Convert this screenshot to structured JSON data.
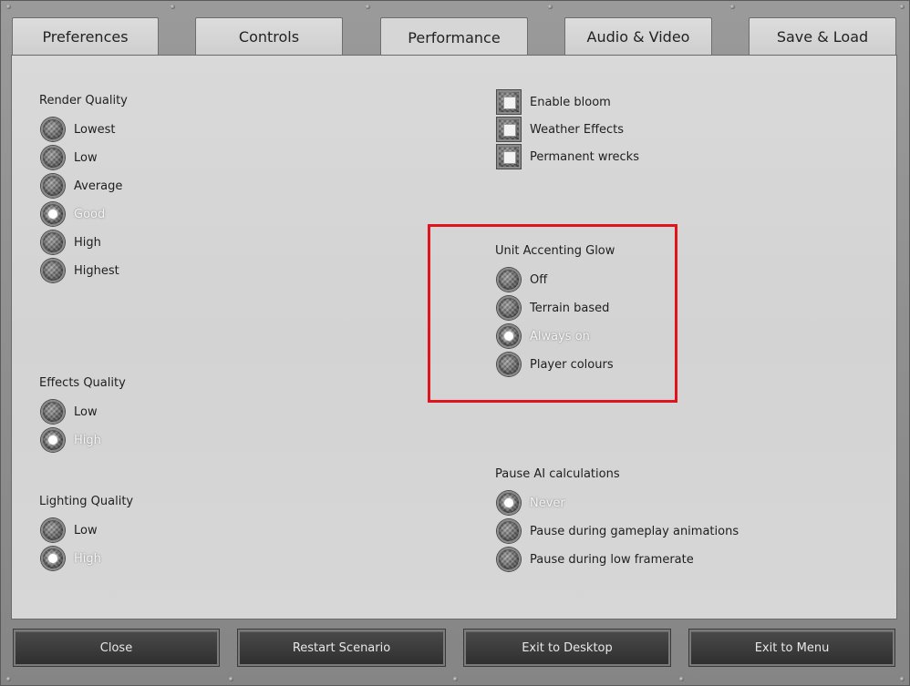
{
  "tabs": [
    {
      "label": "Preferences"
    },
    {
      "label": "Controls"
    },
    {
      "label": "Performance"
    },
    {
      "label": "Audio & Video"
    },
    {
      "label": "Save & Load"
    }
  ],
  "active_tab": "Performance",
  "render_quality": {
    "title": "Render Quality",
    "options": [
      "Lowest",
      "Low",
      "Average",
      "Good",
      "High",
      "Highest"
    ],
    "selected": "Good"
  },
  "effects_quality": {
    "title": "Effects Quality",
    "options": [
      "Low",
      "High"
    ],
    "selected": "High"
  },
  "lighting_quality": {
    "title": "Lighting Quality",
    "options": [
      "Low",
      "High"
    ],
    "selected": "High"
  },
  "toggles": [
    {
      "label": "Enable bloom",
      "checked": true
    },
    {
      "label": "Weather Effects",
      "checked": true
    },
    {
      "label": "Permanent wrecks",
      "checked": true
    }
  ],
  "unit_glow": {
    "title": "Unit Accenting Glow",
    "options": [
      "Off",
      "Terrain based",
      "Always on",
      "Player colours"
    ],
    "selected": "Always on"
  },
  "pause_ai": {
    "title": "Pause AI calculations",
    "options": [
      "Never",
      "Pause during gameplay animations",
      "Pause during low framerate"
    ],
    "selected": "Never"
  },
  "buttons": {
    "close": "Close",
    "restart": "Restart Scenario",
    "exit_desktop": "Exit to Desktop",
    "exit_menu": "Exit to Menu"
  },
  "colors": {
    "highlight": "#e0141c",
    "selected_text": "#f4f4f4"
  }
}
